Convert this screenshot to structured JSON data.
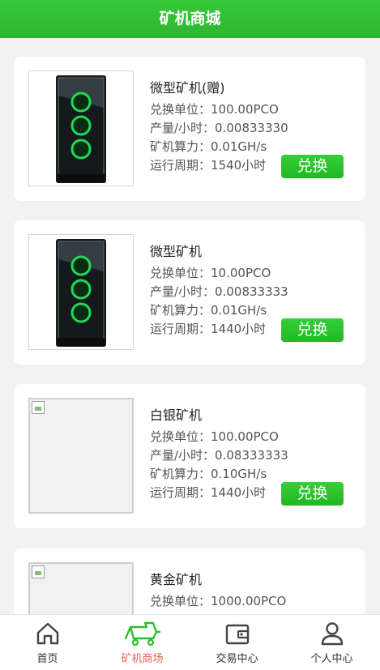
{
  "header": {
    "title": "矿机商城"
  },
  "products": [
    {
      "name": "微型矿机(赠)",
      "price": "兑换单位：100.00PCO",
      "output": "产量/小时：0.00833330",
      "power": "矿机算力：0.01GH/s",
      "period": "运行周期：1540小时",
      "button": "兑换",
      "image": "case-image"
    },
    {
      "name": "微型矿机",
      "price": "兑换单位：10.00PCO",
      "output": "产量/小时：0.00833333",
      "power": "矿机算力：0.01GH/s",
      "period": "运行周期：1440小时",
      "button": "兑换",
      "image": "case-image"
    },
    {
      "name": "白银矿机",
      "price": "兑换单位：100.00PCO",
      "output": "产量/小时：0.08333333",
      "power": "矿机算力：0.10GH/s",
      "period": "运行周期：1440小时",
      "button": "兑换",
      "image": "broken-image"
    },
    {
      "name": "黄金矿机",
      "price": "兑换单位：1000.00PCO",
      "image": "broken-image"
    }
  ],
  "tabbar": {
    "tabs": [
      {
        "label": "首页",
        "icon": "home-icon"
      },
      {
        "label": "矿机商场",
        "icon": "miner-cart-icon",
        "active": true
      },
      {
        "label": "交易中心",
        "icon": "wallet-icon"
      },
      {
        "label": "个人中心",
        "icon": "user-icon"
      }
    ]
  },
  "colors": {
    "accent": "#2fbd31",
    "active_tab": "#e9604d"
  }
}
